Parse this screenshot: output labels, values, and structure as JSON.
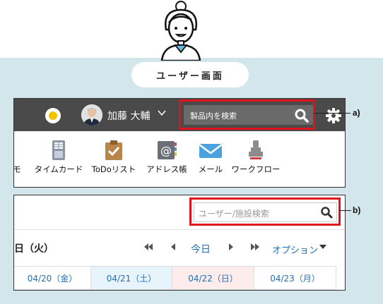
{
  "header": {
    "pill_title": "ユーザー画面"
  },
  "topbar": {
    "user_name": "加藤 大輔",
    "search_placeholder": "製品内を検索"
  },
  "apps": [
    {
      "label": "モ",
      "icon": "memo-icon"
    },
    {
      "label": "タイムカード",
      "icon": "timecard-icon"
    },
    {
      "label": "ToDoリスト",
      "icon": "todo-icon"
    },
    {
      "label": "アドレス帳",
      "icon": "address-book-icon"
    },
    {
      "label": "メール",
      "icon": "mail-icon"
    },
    {
      "label": "ワークフロー",
      "icon": "workflow-icon"
    }
  ],
  "callouts": {
    "a": "a)",
    "b": "b)"
  },
  "schedule": {
    "search_placeholder": "ユーザー/施設検索",
    "date_label": "日（火）",
    "today_label": "今日",
    "options_label": "オプション",
    "days": [
      {
        "label": "04/20（金）",
        "bg": "#ffffff"
      },
      {
        "label": "04/21（土）",
        "bg": "#e8f4fb"
      },
      {
        "label": "04/22（日）",
        "bg": "#fcecec"
      },
      {
        "label": "04/23（月）",
        "bg": "#ffffff"
      }
    ]
  },
  "colors": {
    "accent_red": "#e0121b",
    "link_blue": "#1f6fb8",
    "topbar": "#4a4a4a",
    "background": "#d3e6ec"
  }
}
